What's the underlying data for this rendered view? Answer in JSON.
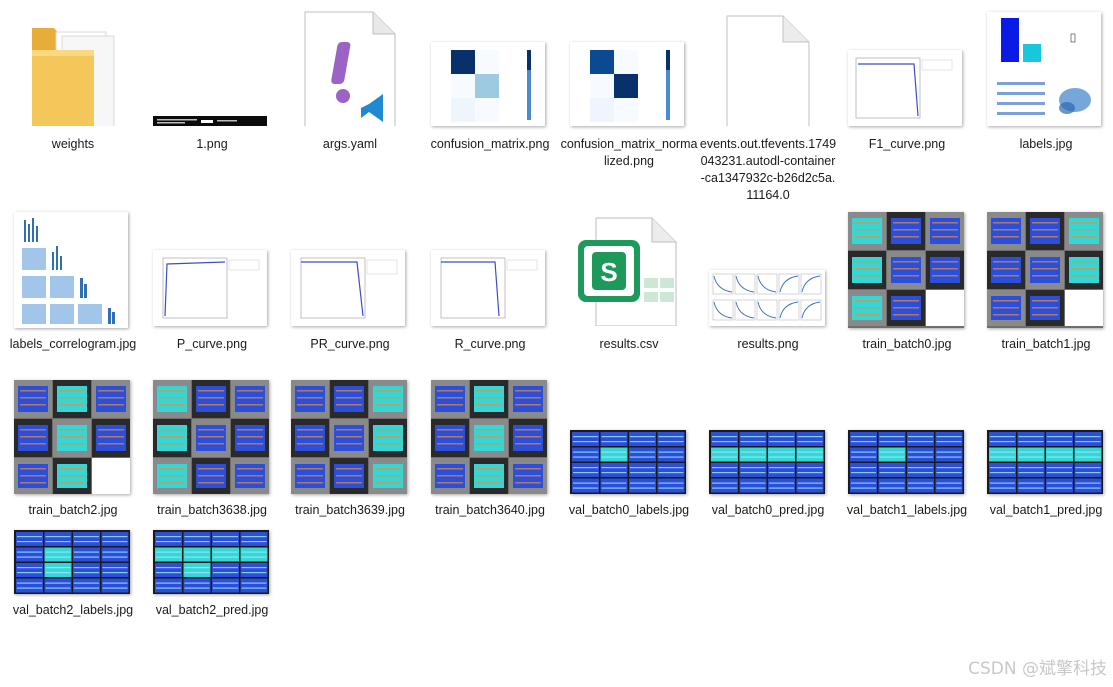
{
  "files": [
    {
      "name": "weights",
      "icon": "folder-icon"
    },
    {
      "name": "1.png",
      "icon": "terminal-image-thumbnail"
    },
    {
      "name": "args.yaml",
      "icon": "yaml-file-icon"
    },
    {
      "name": "confusion_matrix.png",
      "icon": "confusion-matrix-thumbnail"
    },
    {
      "name": "confusion_matrix_normalized.png",
      "icon": "confusion-matrix-normalized-thumbnail"
    },
    {
      "name": "events.out.tfevents.1749043231.autodl-container-ca1347932c-b26d2c5a.11164.0",
      "icon": "blank-file-icon"
    },
    {
      "name": "F1_curve.png",
      "icon": "curve-thumbnail"
    },
    {
      "name": "labels.jpg",
      "icon": "labels-thumbnail"
    },
    {
      "name": "labels_correlogram.jpg",
      "icon": "correlogram-thumbnail"
    },
    {
      "name": "P_curve.png",
      "icon": "curve-thumbnail"
    },
    {
      "name": "PR_curve.png",
      "icon": "curve-thumbnail"
    },
    {
      "name": "R_curve.png",
      "icon": "curve-thumbnail"
    },
    {
      "name": "results.csv",
      "icon": "spreadsheet-file-icon"
    },
    {
      "name": "results.png",
      "icon": "results-thumbnail"
    },
    {
      "name": "train_batch0.jpg",
      "icon": "batch-thumbnail"
    },
    {
      "name": "train_batch1.jpg",
      "icon": "batch-thumbnail"
    },
    {
      "name": "train_batch2.jpg",
      "icon": "batch-thumbnail"
    },
    {
      "name": "train_batch3638.jpg",
      "icon": "batch-thumbnail"
    },
    {
      "name": "train_batch3639.jpg",
      "icon": "batch-thumbnail"
    },
    {
      "name": "train_batch3640.jpg",
      "icon": "batch-thumbnail"
    },
    {
      "name": "val_batch0_labels.jpg",
      "icon": "val-batch-thumbnail"
    },
    {
      "name": "val_batch0_pred.jpg",
      "icon": "val-batch-thumbnail"
    },
    {
      "name": "val_batch1_labels.jpg",
      "icon": "val-batch-thumbnail"
    },
    {
      "name": "val_batch1_pred.jpg",
      "icon": "val-batch-thumbnail"
    },
    {
      "name": "val_batch2_labels.jpg",
      "icon": "val-batch-thumbnail"
    },
    {
      "name": "val_batch2_pred.jpg",
      "icon": "val-batch-thumbnail"
    }
  ],
  "spreadsheet_icon_letter": "S",
  "yaml_icon_mark": "!",
  "watermark": "CSDN @斌擎科技",
  "colors": {
    "folder": "#f4c75a",
    "vscode_blue": "#1f8ad2",
    "yaml_purple": "#9a63c5",
    "excel_green": "#1d9a5b",
    "matrix_dark": "#08306b",
    "matrix_light": "#9ecae1",
    "batch_blue": "#2b4fd8",
    "batch_cyan": "#35d7d6"
  }
}
